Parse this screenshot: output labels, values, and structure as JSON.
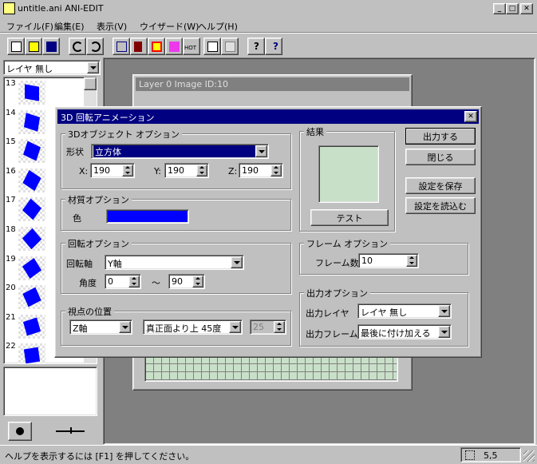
{
  "app": {
    "title": "untitle.ani  ANI-EDIT",
    "menu": [
      "ファイル(F)",
      "編集(E)",
      "表示(V)",
      "ウイザード(W)",
      "ヘルプ(H)"
    ],
    "hot_label": "HOT"
  },
  "layer_select": {
    "value": "レイヤ 無し"
  },
  "frames": [
    "13",
    "14",
    "15",
    "16",
    "17",
    "18",
    "19",
    "20",
    "21",
    "22"
  ],
  "frame_colors": {
    "cube": "#0000ff"
  },
  "image_window": {
    "title": "Layer 0 Image ID:10"
  },
  "dialog": {
    "title": "3D 回転アニメーション",
    "object_group": "3Dオブジェクト オプション",
    "shape_label": "形状",
    "shape_value": "立方体",
    "x_label": "X:",
    "x_value": "190",
    "y_label": "Y:",
    "y_value": "190",
    "z_label": "Z:",
    "z_value": "190",
    "material_group": "材質オプション",
    "color_label": "色",
    "color_value": "#0000ff",
    "rotation_group": "回転オプション",
    "axis_label": "回転軸",
    "axis_value": "Y軸",
    "angle_label": "角度",
    "angle_from": "0",
    "angle_sep": "〜",
    "angle_to": "90",
    "view_group": "視点の位置",
    "view_axis": "Z軸",
    "view_angle": "真正面より上 45度",
    "view_num": "25",
    "result_group": "結果",
    "test_button": "テスト",
    "output_button": "出力する",
    "close_button": "閉じる",
    "save_button": "設定を保存",
    "load_button": "設定を読込む",
    "frame_group": "フレーム オプション",
    "frame_count_label": "フレーム数",
    "frame_count_value": "10",
    "output_group": "出力オプション",
    "out_layer_label": "出力レイヤ",
    "out_layer_value": "レイヤ 無し",
    "out_frame_label": "出力フレーム",
    "out_frame_value": "最後に付け加える"
  },
  "status": {
    "help": "ヘルプを表示するには [F1] を押してください。",
    "coords": "5,5"
  }
}
